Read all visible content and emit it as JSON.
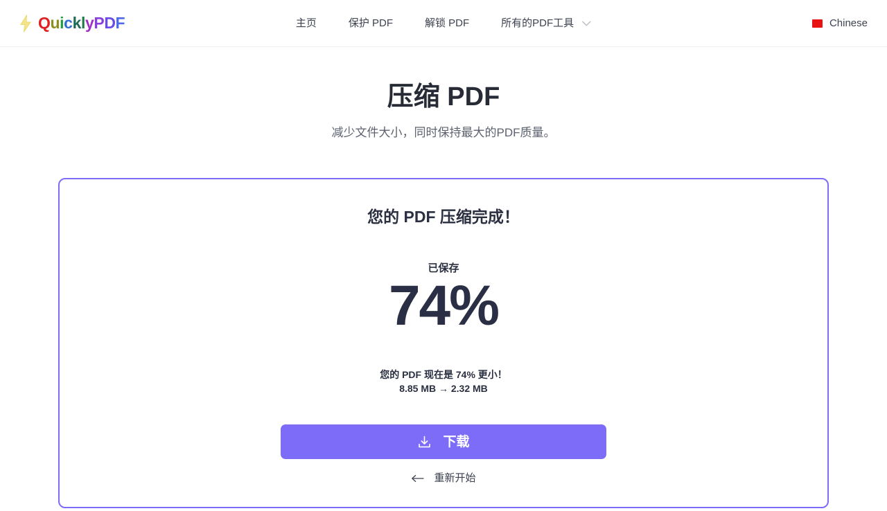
{
  "header": {
    "brand": {
      "icon": "lightning-bolt-icon",
      "letters": [
        {
          "ch": "Q",
          "color": "#e02020"
        },
        {
          "ch": "u",
          "color": "#8a8f1e"
        },
        {
          "ch": "i",
          "color": "#1f9d3c"
        },
        {
          "ch": "c",
          "color": "#2f6fd0"
        },
        {
          "ch": "k",
          "color": "#1f6b57"
        },
        {
          "ch": "l",
          "color": "#1f7a4a"
        },
        {
          "ch": "y",
          "color": "#a02fc8"
        },
        {
          "ch": "P",
          "color": "#8a3fdc"
        },
        {
          "ch": "D",
          "color": "#6a4ae8"
        },
        {
          "ch": "F",
          "color": "#4f6ae8"
        }
      ],
      "full_text": "QuicklyPDF"
    },
    "nav": [
      {
        "label": "主页"
      },
      {
        "label": "保护 PDF"
      },
      {
        "label": "解锁 PDF"
      },
      {
        "label": "所有的PDF工具",
        "icon": "chevron-down-icon",
        "has_dropdown": true
      }
    ],
    "language": {
      "label": "Chinese",
      "flag_icon": "flag-china-icon",
      "flag_color": "#e81212"
    }
  },
  "main": {
    "title": "压缩 PDF",
    "subtitle": "减少文件大小，同时保持最大的PDF质量。"
  },
  "result_card": {
    "border_color": "#7c6cf8",
    "title": "您的 PDF 压缩完成！",
    "saved_label": "已保存",
    "saved_percent": "74%",
    "summary_line": "您的 PDF 现在是 74% 更小！",
    "size_line": "8.85 MB → 2.32 MB",
    "original_size": "8.85 MB",
    "compressed_size": "2.32 MB",
    "download_button": {
      "label": "下载",
      "icon": "download-icon",
      "color": "#7c6cf8"
    },
    "restart_link": {
      "label": "重新开始",
      "icon": "arrow-left-icon"
    }
  }
}
